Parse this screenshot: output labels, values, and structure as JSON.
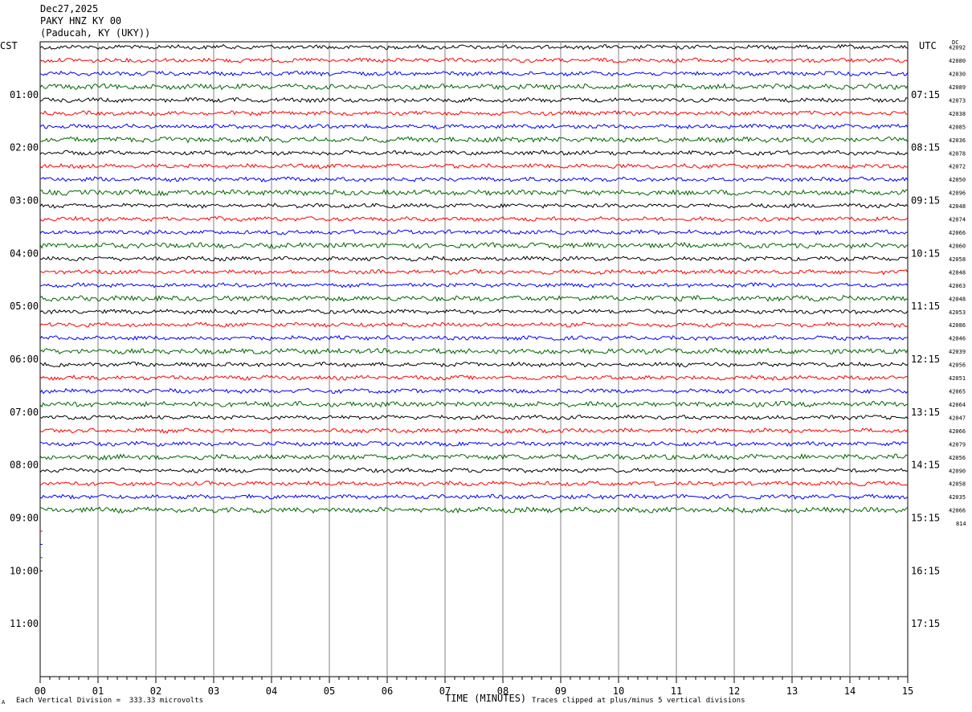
{
  "header": {
    "date": "Dec27,2025",
    "station": "PAKY HNZ KY 00",
    "location": "(Paducah, KY (UKY))"
  },
  "labels": {
    "left_timezone": "CST",
    "right_timezone": "UTC",
    "dc_label": "DC"
  },
  "footer": {
    "scale_note": "Each Vertical Division =  333.33 microvolts",
    "clip_note": "Traces clipped at plus/minus 5 vertical divisions",
    "corner_mark": "A"
  },
  "colors": {
    "trace_cycle": [
      "#000000",
      "#ff0000",
      "#0000ff",
      "#006600"
    ],
    "grid": "#808080",
    "background": "#ffffff"
  },
  "chart_data": {
    "type": "line",
    "title": "",
    "xlabel": "TIME (MINUTES)",
    "ylabel": "",
    "xlim": [
      0,
      15
    ],
    "x_ticks": [
      "00",
      "01",
      "02",
      "03",
      "04",
      "05",
      "06",
      "07",
      "08",
      "09",
      "10",
      "11",
      "12",
      "13",
      "14",
      "15"
    ],
    "grid": true,
    "rows_total": 48,
    "rows_with_data": 36,
    "left_hour_labels": [
      "01:00",
      "02:00",
      "03:00",
      "04:00",
      "05:00",
      "06:00",
      "07:00",
      "08:00",
      "09:00",
      "10:00",
      "11:00"
    ],
    "right_hour_labels": [
      "07:15",
      "08:15",
      "09:15",
      "10:15",
      "11:15",
      "12:15",
      "13:15",
      "14:15",
      "15:15",
      "16:15",
      "17:15"
    ],
    "dc_offsets": [
      "42092",
      "42080",
      "42030",
      "42089",
      "42073",
      "42038",
      "42085",
      "42036",
      "42078",
      "42072",
      "42050",
      "42096",
      "42048",
      "42074",
      "42066",
      "42060",
      "42058",
      "42048",
      "42063",
      "42048",
      "42053",
      "42086",
      "42046",
      "42039",
      "42056",
      "42051",
      "42065",
      "42064",
      "42047",
      "42066",
      "42079",
      "42056",
      "42090",
      "42058",
      "42035",
      "42066",
      "814"
    ]
  }
}
